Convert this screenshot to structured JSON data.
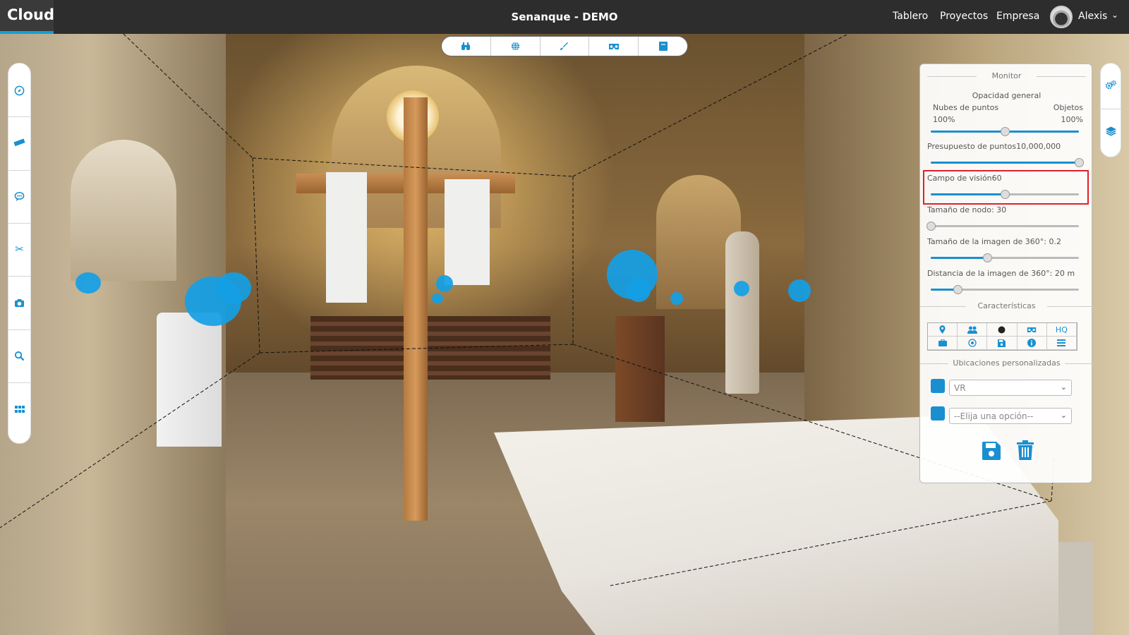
{
  "topbar": {
    "brand": "Cloud",
    "title": "Senanque - DEMO",
    "nav": [
      "Tablero",
      "Proyectos",
      "Empresa"
    ],
    "user": "Alexis"
  },
  "left_toolbar": {
    "icons": [
      "compass-icon",
      "ruler-icon",
      "comment-icon",
      "scissors-icon",
      "camera-icon",
      "search-icon",
      "grid-icon"
    ]
  },
  "mode_bar": {
    "icons": [
      "binoculars-icon",
      "globe-icon",
      "brush-icon",
      "vr-headset-icon",
      "map-icon"
    ]
  },
  "right_toolbar": {
    "icons": [
      "settings-icon",
      "layers-icon"
    ]
  },
  "monitor": {
    "title": "Monitor",
    "opacity_label": "Opacidad general",
    "point_clouds_label": "Nubes de puntos",
    "objects_label": "Objetos",
    "point_clouds_value": "100%",
    "objects_value": "100%",
    "opacity_balance": 0.5,
    "budget_label": "Presupuesto de puntos10,000,000",
    "budget_fraction": 1.0,
    "fov_label": "Campo de visión60",
    "fov_fraction": 0.5,
    "node_size_label": "Tamaño de nodo: 30",
    "node_size_fraction": 0.0,
    "image_size_label": "Tamaño de la imagen de 360°: 0.2",
    "image_size_fraction": 0.38,
    "image_distance_label": "Distancia de la imagen de 360°: 20 m",
    "image_distance_fraction": 0.18,
    "features_title": "Características",
    "features_hq": "HQ",
    "custom_locations_title": "Ubicaciones personalizadas",
    "select_1_value": "VR",
    "select_2_value": "--Elija una opción--"
  },
  "colors": {
    "accent": "#1a8fd0",
    "highlight": "#e0202a",
    "topbar": "#2d2d2d"
  }
}
